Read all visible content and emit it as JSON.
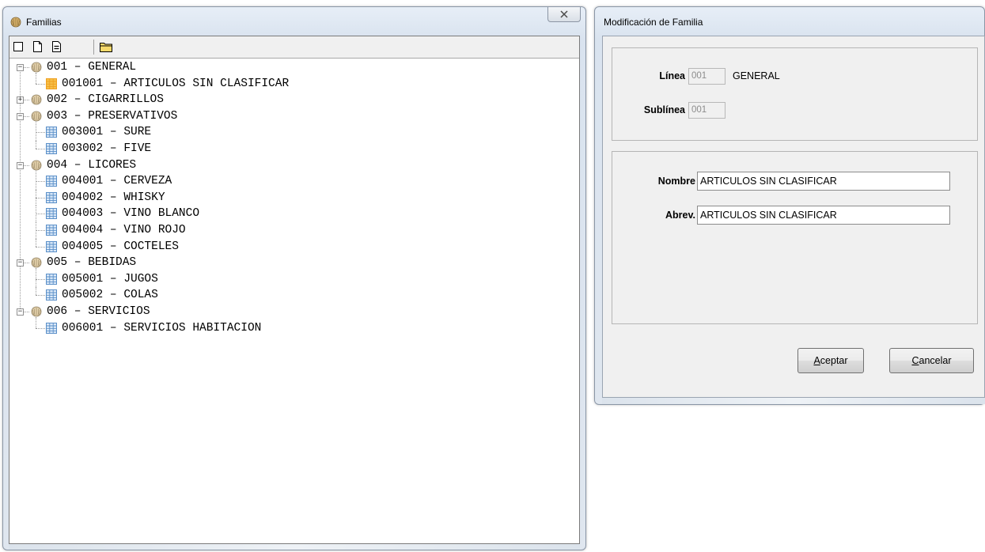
{
  "familias_window": {
    "title": "Familias",
    "close_glyph": "☒",
    "toolbar": [
      {
        "icon": "new-blank-icon"
      },
      {
        "icon": "new-document-icon"
      },
      {
        "icon": "edit-document-icon"
      },
      {
        "icon": "folder-icon"
      }
    ],
    "tree": [
      {
        "code": "001 – GENERAL",
        "level": 0,
        "expanded": true,
        "icon": "shell-icon"
      },
      {
        "code": "001001 – ARTICULOS SIN CLASIFICAR",
        "level": 1,
        "selected": true,
        "icon": "table-icon"
      },
      {
        "code": "002 – CIGARRILLOS",
        "level": 0,
        "expanded": false,
        "icon": "shell-icon"
      },
      {
        "code": "003 – PRESERVATIVOS",
        "level": 0,
        "expanded": true,
        "icon": "shell-icon"
      },
      {
        "code": "003001 – SURE",
        "level": 1,
        "icon": "table-icon"
      },
      {
        "code": "003002 – FIVE",
        "level": 1,
        "icon": "table-icon"
      },
      {
        "code": "004 – LICORES",
        "level": 0,
        "expanded": true,
        "icon": "shell-icon"
      },
      {
        "code": "004001 – CERVEZA",
        "level": 1,
        "icon": "table-icon"
      },
      {
        "code": "004002 – WHISKY",
        "level": 1,
        "icon": "table-icon"
      },
      {
        "code": "004003 – VINO BLANCO",
        "level": 1,
        "icon": "table-icon"
      },
      {
        "code": "004004 – VINO ROJO",
        "level": 1,
        "icon": "table-icon"
      },
      {
        "code": "004005 – COCTELES",
        "level": 1,
        "icon": "table-icon"
      },
      {
        "code": "005 – BEBIDAS",
        "level": 0,
        "expanded": true,
        "icon": "shell-icon"
      },
      {
        "code": "005001 – JUGOS",
        "level": 1,
        "icon": "table-icon"
      },
      {
        "code": "005002 – COLAS",
        "level": 1,
        "icon": "table-icon"
      },
      {
        "code": "006 – SERVICIOS",
        "level": 0,
        "expanded": true,
        "icon": "shell-icon"
      },
      {
        "code": "006001 – SERVICIOS HABITACION",
        "level": 1,
        "icon": "table-icon"
      }
    ]
  },
  "modificacion_window": {
    "title": "Modificación de Familia",
    "linea": {
      "label": "Línea",
      "code": "001",
      "name": "GENERAL"
    },
    "sublinea": {
      "label": "Sublínea",
      "code": "001"
    },
    "nombre": {
      "label": "Nombre",
      "value": "ARTICULOS SIN CLASIFICAR"
    },
    "abrev": {
      "label": "Abrev.",
      "value": "ARTICULOS SIN CLASIFICAR"
    },
    "aceptar": {
      "hotkey": "A",
      "rest": "ceptar"
    },
    "cancelar": {
      "hotkey": "C",
      "rest": "ancelar"
    }
  },
  "colors": {
    "selected_item_icon": "#f0a020",
    "item_icon": "#5a8fc8",
    "title_gradient": "#dfe6ef"
  }
}
